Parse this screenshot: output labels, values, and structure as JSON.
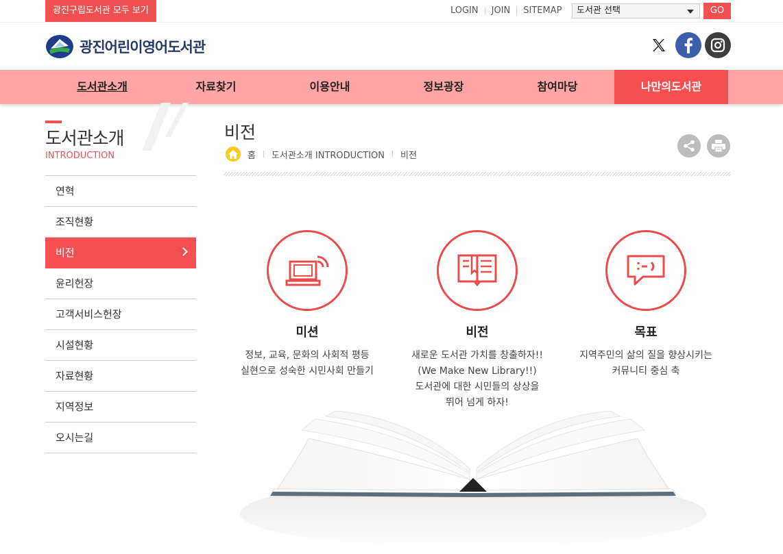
{
  "topbar": {
    "all_libraries": "광진구립도서관 모두 보기",
    "links": [
      "LOGIN",
      "JOIN",
      "SITEMAP"
    ],
    "library_select": "도서관 선택",
    "go": "GO"
  },
  "header": {
    "logo_text": "광진어린이영어도서관"
  },
  "gnb": {
    "items": [
      "도서관소개",
      "자료찾기",
      "이용안내",
      "정보광장",
      "참여마당",
      "나만의도서관"
    ]
  },
  "lnb": {
    "title": "도서관소개",
    "subtitle": "INTRODUCTION",
    "items": [
      "연혁",
      "조직현황",
      "비전",
      "윤리헌장",
      "고객서비스헌장",
      "시설현황",
      "자료현황",
      "지역정보",
      "오시는길"
    ]
  },
  "content": {
    "title": "비전",
    "breadcrumb": [
      "홈",
      "도서관소개 INTRODUCTION",
      "비전"
    ]
  },
  "vision": [
    {
      "title": "미션",
      "desc": "정보, 교육, 문화의 사회적 평등\n실현으로 성숙한 시민사회 만들기",
      "icon": "computer-wifi-icon"
    },
    {
      "title": "비전",
      "desc": "새로운 도서관 가치를 창출하자!!\n(We Make New Library!!)\n도서관에 대한 시민들의 상상을\n뛰어 넘게 하자!",
      "icon": "open-book-icon"
    },
    {
      "title": "목표",
      "desc": "지역주민의 삶의 질을 향상시키는\n커뮤니티 중심 축",
      "icon": "chat-bubble-icon"
    }
  ],
  "colors": {
    "accent": "#f05050",
    "gnb_bg": "#ffa5a5",
    "gnb_active": "#f54f50",
    "logo_navy": "#243a6b",
    "facebook": "#3b5fab"
  }
}
